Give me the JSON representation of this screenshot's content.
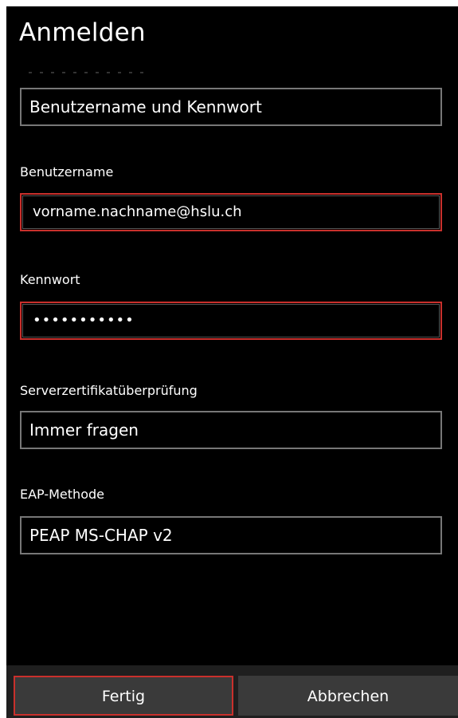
{
  "page": {
    "title": "Anmelden"
  },
  "auth_type": {
    "value": "Benutzername und Kennwort"
  },
  "username": {
    "label": "Benutzername",
    "value": "vorname.nachname@hslu.ch"
  },
  "password": {
    "label": "Kennwort",
    "masked_value": "•••••••••••"
  },
  "server_cert_check": {
    "label": "Serverzertifikatüberprüfung",
    "value": "Immer fragen"
  },
  "eap_method": {
    "label": "EAP-Methode",
    "value": "PEAP MS-CHAP v2"
  },
  "app_bar": {
    "done_label": "Fertig",
    "cancel_label": "Abbrechen"
  },
  "colors": {
    "background": "#000000",
    "text": "#ffffff",
    "highlight_border": "#c9302c",
    "field_border": "#777777",
    "button_background": "#3a3a3a",
    "app_bar_background": "#1f1f1f"
  }
}
